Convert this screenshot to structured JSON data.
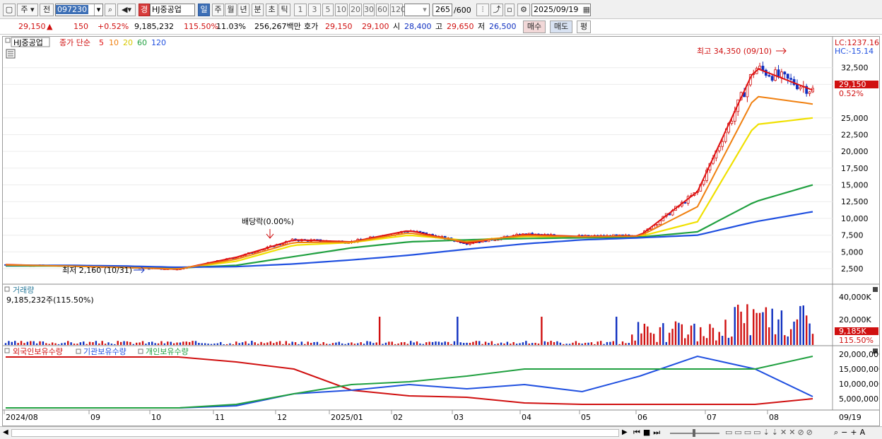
{
  "toolbar": {
    "period_main": "주",
    "prev_label": "전",
    "code": "097230",
    "stock_badge": "경",
    "stock_name": "HJ중공업",
    "periods": [
      "일",
      "주",
      "월",
      "년",
      "분",
      "초",
      "틱"
    ],
    "selected_period": "일",
    "intervals": [
      "1",
      "3",
      "5",
      "10",
      "20",
      "30",
      "60",
      "120"
    ],
    "count": "265",
    "count_total": "/600",
    "date": "2025/09/19"
  },
  "quote": {
    "price": "29,150",
    "change": "150",
    "change_pct": "+0.52%",
    "volume": "9,185,232",
    "volume_ratio": "115.50%",
    "turnover": "11.03%",
    "amount": "256,267백만",
    "bid_label": "호가",
    "ask": "29,150",
    "bid": "29,100",
    "open_label": "시",
    "open": "28,400",
    "high_label": "고",
    "high": "29,650",
    "low_label": "저",
    "low": "26,500",
    "buy_label": "매수",
    "sell_label": "매도",
    "eval_label": "평"
  },
  "price_panel": {
    "stock_tag": "HJ중공업",
    "ma_label": "종가 단순",
    "ma_periods": [
      "5",
      "10",
      "20",
      "60",
      "120"
    ],
    "lc": "LC:1237.16",
    "hc": "HC:-15.14",
    "high_note": "최고 34,350 (09/10)",
    "low_note": "최저 2,160 (10/31)",
    "dividend_note": "배당락(0.00%)",
    "current_price_tag": "29,150",
    "current_pct_tag": "0.52%",
    "y_ticks": [
      "32,500",
      "30,000",
      "25,000",
      "22,500",
      "20,000",
      "17,500",
      "15,000",
      "12,500",
      "10,000",
      "7,500",
      "5,000",
      "2,500"
    ]
  },
  "volume_panel": {
    "title": "거래량",
    "value": "9,185,232주(115.50%)",
    "y_ticks": [
      "40,000K",
      "20,000K"
    ],
    "current_tag": "9,185K",
    "pct_tag": "115.50%"
  },
  "holding_panel": {
    "legend": [
      "외국인보유수량",
      "기관보유수량",
      "개인보유수량"
    ],
    "y_ticks": [
      "20,000,000",
      "15,000,000",
      "10,000,000",
      "5,000,000"
    ]
  },
  "x_axis": {
    "labels": [
      "2024/08",
      "09",
      "10",
      "11",
      "12",
      "2025/01",
      "02",
      "03",
      "04",
      "05",
      "06",
      "07",
      "08",
      "09"
    ],
    "end_label": "09/19"
  },
  "colors": {
    "up": "#d01010",
    "down": "#1030c0",
    "ma5": "#e01010",
    "ma10": "#f08010",
    "ma20": "#f0e000",
    "ma60": "#20a040",
    "ma120": "#2050e0",
    "accent": "#3d6fb6"
  },
  "chart_data": {
    "type": "line",
    "title": "HJ중공업",
    "x": [
      "2024/08",
      "09",
      "10",
      "11",
      "12",
      "2025/01",
      "02",
      "03",
      "04",
      "05",
      "06",
      "07",
      "08",
      "09",
      "09/19"
    ],
    "series": [
      {
        "name": "종가",
        "values": [
          3100,
          2900,
          2700,
          2400,
          4200,
          6800,
          6500,
          8200,
          6300,
          7600,
          7300,
          7400,
          14000,
          32500,
          29150
        ]
      },
      {
        "name": "20",
        "values": [
          3000,
          2900,
          2700,
          2500,
          3600,
          6000,
          6400,
          7500,
          6700,
          7300,
          7200,
          7300,
          9500,
          24000,
          25000
        ]
      },
      {
        "name": "60",
        "values": [
          2900,
          2900,
          2800,
          2600,
          3000,
          4300,
          5600,
          6500,
          6800,
          7000,
          7100,
          7200,
          8000,
          12500,
          15000
        ]
      },
      {
        "name": "120",
        "values": [
          3000,
          3000,
          2900,
          2700,
          2800,
          3200,
          3800,
          4500,
          5400,
          6200,
          6800,
          7100,
          7500,
          9500,
          11000
        ]
      }
    ],
    "ylim": [
      0,
      35000
    ],
    "grid": true
  }
}
